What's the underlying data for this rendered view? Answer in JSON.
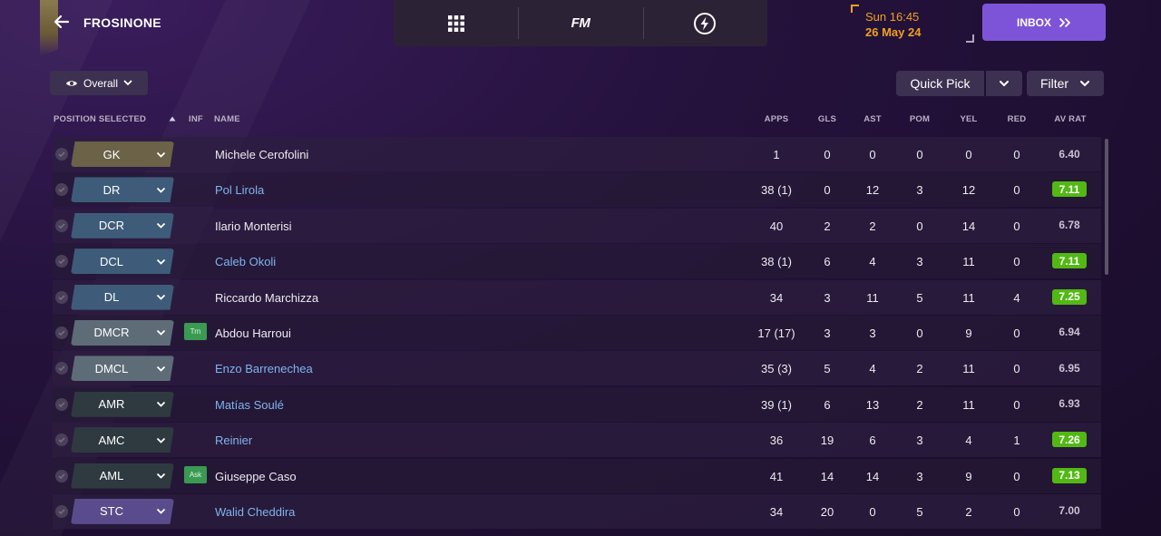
{
  "header": {
    "club_name": "FROSINONE",
    "time": "Sun 16:45",
    "date": "26 May 24",
    "fm_logo": "FM",
    "inbox_label": "INBOX"
  },
  "toolbar": {
    "view_label": "Overall",
    "quick_pick_label": "Quick Pick",
    "filter_label": "Filter"
  },
  "columns": {
    "position": "POSITION SELECTED",
    "inf": "INF",
    "name": "NAME",
    "apps": "APPS",
    "gls": "GLS",
    "ast": "AST",
    "pom": "POM",
    "yel": "YEL",
    "red": "RED",
    "avrat": "AV RAT"
  },
  "colors": {
    "accent_purple": "#7d54d8",
    "date_orange": "#f0a020",
    "rating_green": "#52b814",
    "link_blue": "#7fb4ee",
    "pos_gk": "#6b6248",
    "pos_def": "#3e5c7a",
    "pos_dm": "#5e6c78",
    "pos_am": "#2e3a40",
    "pos_st": "#5a4c8c"
  },
  "players": [
    {
      "pos": "GK",
      "pos_group": "gk",
      "inf": "",
      "name": "Michele Cerofolini",
      "link": false,
      "apps": "1",
      "gls": "0",
      "ast": "0",
      "pom": "0",
      "yel": "0",
      "red": "0",
      "avrat": "6.40",
      "highlight": false
    },
    {
      "pos": "DR",
      "pos_group": "def",
      "inf": "",
      "name": "Pol Lirola",
      "link": true,
      "apps": "38 (1)",
      "gls": "0",
      "ast": "12",
      "pom": "3",
      "yel": "12",
      "red": "0",
      "avrat": "7.11",
      "highlight": true
    },
    {
      "pos": "DCR",
      "pos_group": "def",
      "inf": "",
      "name": "Ilario Monterisi",
      "link": false,
      "apps": "40",
      "gls": "2",
      "ast": "2",
      "pom": "0",
      "yel": "14",
      "red": "0",
      "avrat": "6.78",
      "highlight": false
    },
    {
      "pos": "DCL",
      "pos_group": "def",
      "inf": "",
      "name": "Caleb Okoli",
      "link": true,
      "apps": "38 (1)",
      "gls": "6",
      "ast": "4",
      "pom": "3",
      "yel": "11",
      "red": "0",
      "avrat": "7.11",
      "highlight": true
    },
    {
      "pos": "DL",
      "pos_group": "def",
      "inf": "",
      "name": "Riccardo Marchizza",
      "link": false,
      "apps": "34",
      "gls": "3",
      "ast": "11",
      "pom": "5",
      "yel": "11",
      "red": "4",
      "avrat": "7.25",
      "highlight": true
    },
    {
      "pos": "DMCR",
      "pos_group": "dm",
      "inf": "Trn",
      "name": "Abdou Harroui",
      "link": false,
      "apps": "17 (17)",
      "gls": "3",
      "ast": "3",
      "pom": "0",
      "yel": "9",
      "red": "0",
      "avrat": "6.94",
      "highlight": false
    },
    {
      "pos": "DMCL",
      "pos_group": "dm",
      "inf": "",
      "name": "Enzo Barrenechea",
      "link": true,
      "apps": "35 (3)",
      "gls": "5",
      "ast": "4",
      "pom": "2",
      "yel": "11",
      "red": "0",
      "avrat": "6.95",
      "highlight": false
    },
    {
      "pos": "AMR",
      "pos_group": "am",
      "inf": "",
      "name": "Matías Soulé",
      "link": true,
      "apps": "39 (1)",
      "gls": "6",
      "ast": "13",
      "pom": "2",
      "yel": "11",
      "red": "0",
      "avrat": "6.93",
      "highlight": false
    },
    {
      "pos": "AMC",
      "pos_group": "am",
      "inf": "",
      "name": "Reinier",
      "link": true,
      "apps": "36",
      "gls": "19",
      "ast": "6",
      "pom": "3",
      "yel": "4",
      "red": "1",
      "avrat": "7.26",
      "highlight": true
    },
    {
      "pos": "AML",
      "pos_group": "am",
      "inf": "Ask",
      "name": "Giuseppe Caso",
      "link": false,
      "apps": "41",
      "gls": "14",
      "ast": "14",
      "pom": "3",
      "yel": "9",
      "red": "0",
      "avrat": "7.13",
      "highlight": true
    },
    {
      "pos": "STC",
      "pos_group": "st",
      "inf": "",
      "name": "Walid Cheddira",
      "link": true,
      "apps": "34",
      "gls": "20",
      "ast": "0",
      "pom": "5",
      "yel": "2",
      "red": "0",
      "avrat": "7.00",
      "highlight": false
    }
  ]
}
